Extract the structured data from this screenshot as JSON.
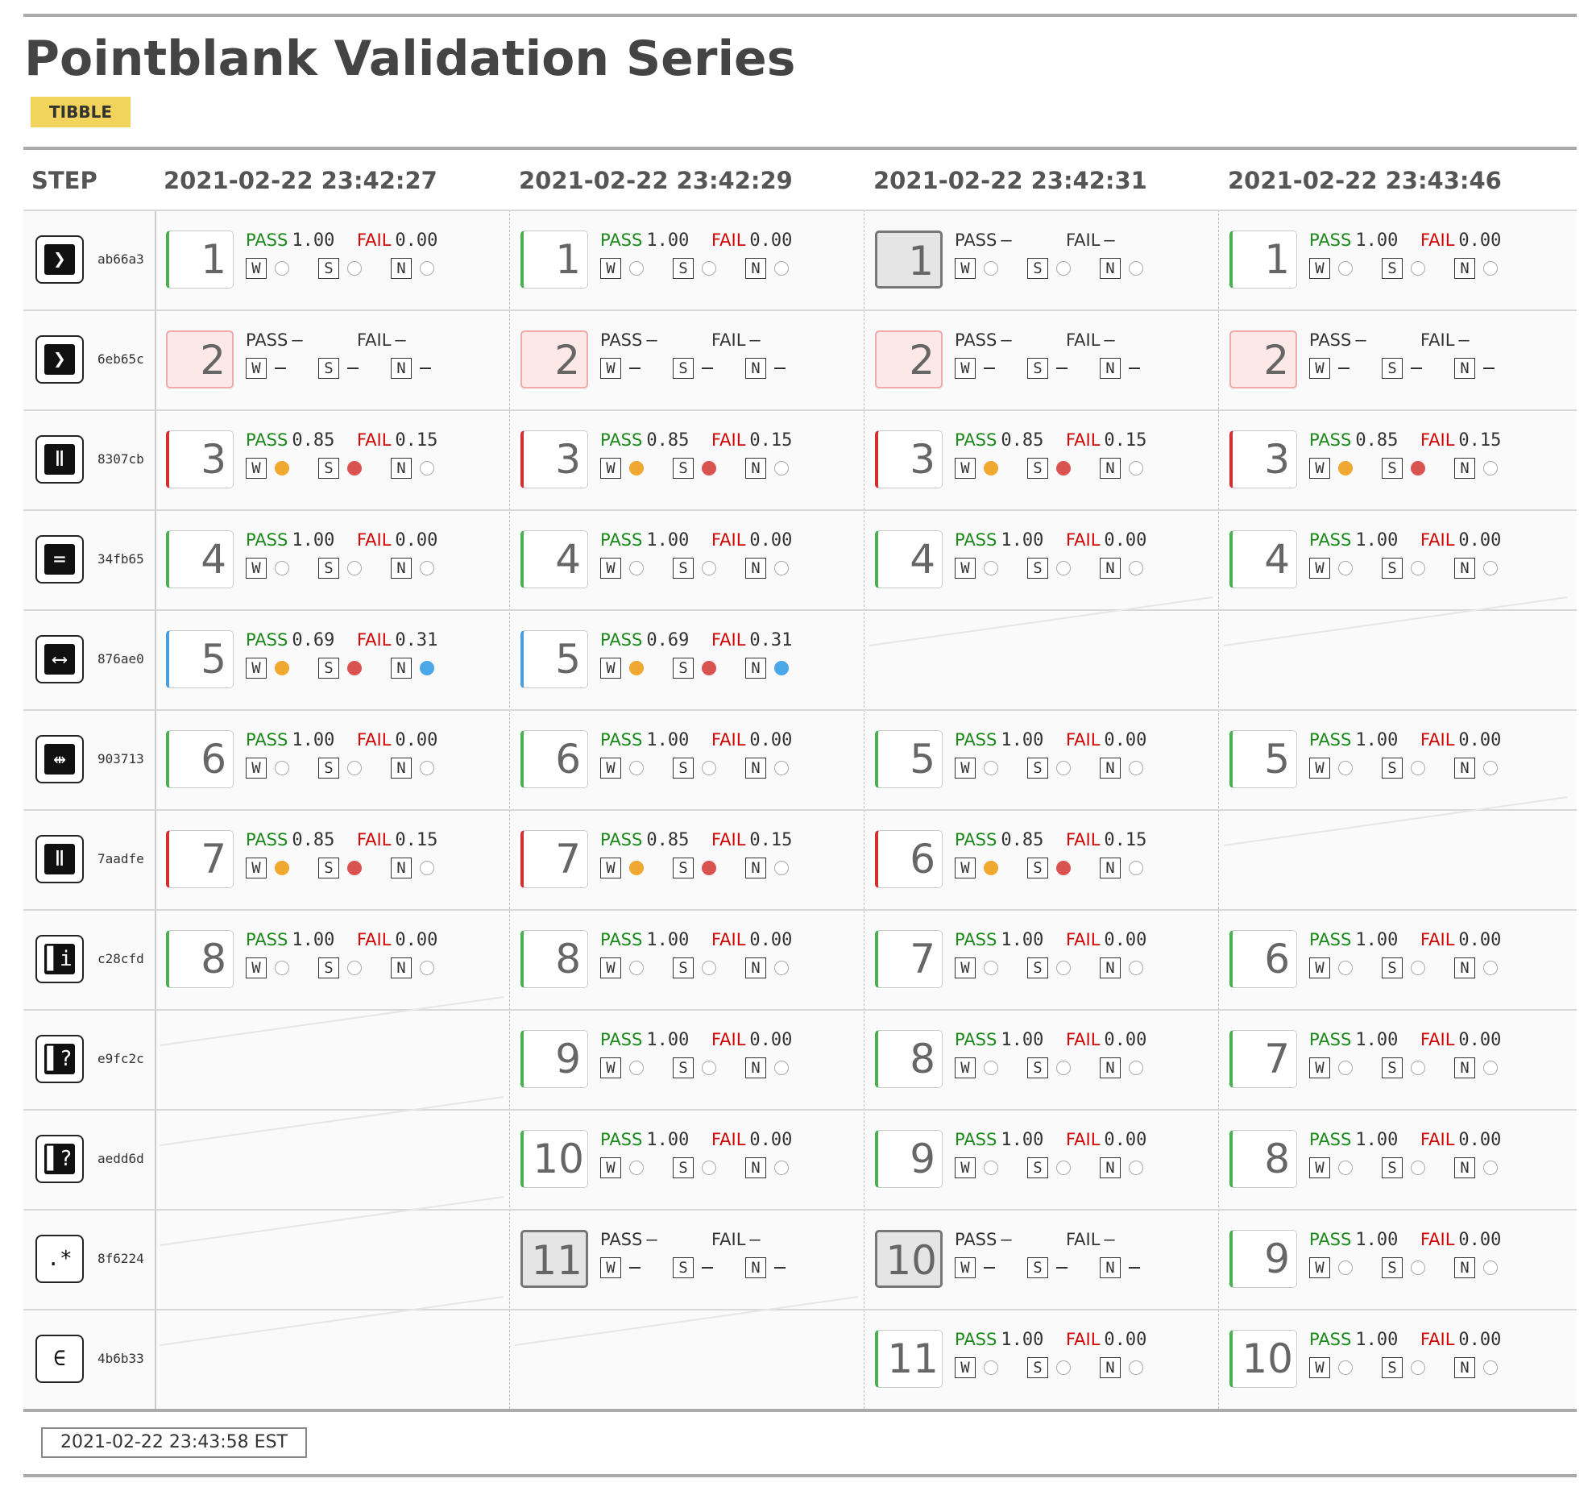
{
  "title": "Pointblank Validation Series",
  "badge": "TIBBLE",
  "columns": {
    "step_header": "STEP",
    "runs": [
      "2021-02-22 23:42:27",
      "2021-02-22 23:42:29",
      "2021-02-22 23:42:31",
      "2021-02-22 23:43:46"
    ]
  },
  "labels": {
    "pass": "PASS",
    "fail": "FAIL",
    "w": "W",
    "s": "S",
    "n": "N"
  },
  "colors": {
    "pass": "#1a8a1a",
    "fail": "#d30000",
    "warn": "#f0a830",
    "stop": "#d9534f",
    "notify": "#4aa8e8",
    "badge": "#f2d35b"
  },
  "steps": [
    {
      "hash": "ab66a3",
      "icon": "greater-than-icon",
      "glyph": "❯"
    },
    {
      "hash": "6eb65c",
      "icon": "greater-than-icon",
      "glyph": "❯"
    },
    {
      "hash": "8307cb",
      "icon": "between-icon",
      "glyph": "Ⅱ"
    },
    {
      "hash": "34fb65",
      "icon": "equals-icon",
      "glyph": "="
    },
    {
      "hash": "876ae0",
      "icon": "col-vals-between-icon",
      "glyph": "⟷"
    },
    {
      "hash": "903713",
      "icon": "col-vals-not-between-icon",
      "glyph": "⇹"
    },
    {
      "hash": "7aadfe",
      "icon": "between-icon",
      "glyph": "Ⅱ"
    },
    {
      "hash": "c28cfd",
      "icon": "col-is-info-icon",
      "glyph": "▌i"
    },
    {
      "hash": "e9fc2c",
      "icon": "col-exists-icon",
      "glyph": "▌?"
    },
    {
      "hash": "aedd6d",
      "icon": "col-exists-icon",
      "glyph": "▌?"
    },
    {
      "hash": "8f6224",
      "icon": "regex-icon",
      "glyph": ".*"
    },
    {
      "hash": "4b6b33",
      "icon": "in-set-icon",
      "glyph": "∈"
    }
  ],
  "cells": [
    [
      {
        "n": "1",
        "t": "pass",
        "p": "1.00",
        "f": "0.00",
        "w": "none",
        "s": "none",
        "nn": "none"
      },
      {
        "n": "1",
        "t": "pass",
        "p": "1.00",
        "f": "0.00",
        "w": "none",
        "s": "none",
        "nn": "none"
      },
      {
        "n": "1",
        "t": "inactive",
        "p": "—",
        "f": "—",
        "w": "none",
        "s": "none",
        "nn": "none"
      },
      {
        "n": "1",
        "t": "pass",
        "p": "1.00",
        "f": "0.00",
        "w": "none",
        "s": "none",
        "nn": "none"
      }
    ],
    [
      {
        "n": "2",
        "t": "err",
        "p": "—",
        "f": "—",
        "w": "dash",
        "s": "dash",
        "nn": "dash"
      },
      {
        "n": "2",
        "t": "err",
        "p": "—",
        "f": "—",
        "w": "dash",
        "s": "dash",
        "nn": "dash"
      },
      {
        "n": "2",
        "t": "err",
        "p": "—",
        "f": "—",
        "w": "dash",
        "s": "dash",
        "nn": "dash"
      },
      {
        "n": "2",
        "t": "err",
        "p": "—",
        "f": "—",
        "w": "dash",
        "s": "dash",
        "nn": "dash"
      }
    ],
    [
      {
        "n": "3",
        "t": "fail",
        "p": "0.85",
        "f": "0.15",
        "w": "warn",
        "s": "stop",
        "nn": "none"
      },
      {
        "n": "3",
        "t": "fail",
        "p": "0.85",
        "f": "0.15",
        "w": "warn",
        "s": "stop",
        "nn": "none"
      },
      {
        "n": "3",
        "t": "fail",
        "p": "0.85",
        "f": "0.15",
        "w": "warn",
        "s": "stop",
        "nn": "none"
      },
      {
        "n": "3",
        "t": "fail",
        "p": "0.85",
        "f": "0.15",
        "w": "warn",
        "s": "stop",
        "nn": "none"
      }
    ],
    [
      {
        "n": "4",
        "t": "pass",
        "p": "1.00",
        "f": "0.00",
        "w": "none",
        "s": "none",
        "nn": "none"
      },
      {
        "n": "4",
        "t": "pass",
        "p": "1.00",
        "f": "0.00",
        "w": "none",
        "s": "none",
        "nn": "none"
      },
      {
        "n": "4",
        "t": "pass",
        "p": "1.00",
        "f": "0.00",
        "w": "none",
        "s": "none",
        "nn": "none"
      },
      {
        "n": "4",
        "t": "pass",
        "p": "1.00",
        "f": "0.00",
        "w": "none",
        "s": "none",
        "nn": "none"
      }
    ],
    [
      {
        "n": "5",
        "t": "note",
        "p": "0.69",
        "f": "0.31",
        "w": "warn",
        "s": "stop",
        "nn": "notify"
      },
      {
        "n": "5",
        "t": "note",
        "p": "0.69",
        "f": "0.31",
        "w": "warn",
        "s": "stop",
        "nn": "notify"
      },
      null,
      null
    ],
    [
      {
        "n": "6",
        "t": "pass",
        "p": "1.00",
        "f": "0.00",
        "w": "none",
        "s": "none",
        "nn": "none"
      },
      {
        "n": "6",
        "t": "pass",
        "p": "1.00",
        "f": "0.00",
        "w": "none",
        "s": "none",
        "nn": "none"
      },
      {
        "n": "5",
        "t": "pass",
        "p": "1.00",
        "f": "0.00",
        "w": "none",
        "s": "none",
        "nn": "none"
      },
      {
        "n": "5",
        "t": "pass",
        "p": "1.00",
        "f": "0.00",
        "w": "none",
        "s": "none",
        "nn": "none"
      }
    ],
    [
      {
        "n": "7",
        "t": "fail",
        "p": "0.85",
        "f": "0.15",
        "w": "warn",
        "s": "stop",
        "nn": "none"
      },
      {
        "n": "7",
        "t": "fail",
        "p": "0.85",
        "f": "0.15",
        "w": "warn",
        "s": "stop",
        "nn": "none"
      },
      {
        "n": "6",
        "t": "fail",
        "p": "0.85",
        "f": "0.15",
        "w": "warn",
        "s": "stop",
        "nn": "none"
      },
      null
    ],
    [
      {
        "n": "8",
        "t": "pass",
        "p": "1.00",
        "f": "0.00",
        "w": "none",
        "s": "none",
        "nn": "none"
      },
      {
        "n": "8",
        "t": "pass",
        "p": "1.00",
        "f": "0.00",
        "w": "none",
        "s": "none",
        "nn": "none"
      },
      {
        "n": "7",
        "t": "pass",
        "p": "1.00",
        "f": "0.00",
        "w": "none",
        "s": "none",
        "nn": "none"
      },
      {
        "n": "6",
        "t": "pass",
        "p": "1.00",
        "f": "0.00",
        "w": "none",
        "s": "none",
        "nn": "none"
      }
    ],
    [
      null,
      {
        "n": "9",
        "t": "pass",
        "p": "1.00",
        "f": "0.00",
        "w": "none",
        "s": "none",
        "nn": "none"
      },
      {
        "n": "8",
        "t": "pass",
        "p": "1.00",
        "f": "0.00",
        "w": "none",
        "s": "none",
        "nn": "none"
      },
      {
        "n": "7",
        "t": "pass",
        "p": "1.00",
        "f": "0.00",
        "w": "none",
        "s": "none",
        "nn": "none"
      }
    ],
    [
      null,
      {
        "n": "10",
        "t": "pass",
        "p": "1.00",
        "f": "0.00",
        "w": "none",
        "s": "none",
        "nn": "none"
      },
      {
        "n": "9",
        "t": "pass",
        "p": "1.00",
        "f": "0.00",
        "w": "none",
        "s": "none",
        "nn": "none"
      },
      {
        "n": "8",
        "t": "pass",
        "p": "1.00",
        "f": "0.00",
        "w": "none",
        "s": "none",
        "nn": "none"
      }
    ],
    [
      null,
      {
        "n": "11",
        "t": "inactive",
        "p": "—",
        "f": "—",
        "w": "dash",
        "s": "dash",
        "nn": "dash"
      },
      {
        "n": "10",
        "t": "inactive",
        "p": "—",
        "f": "—",
        "w": "dash",
        "s": "dash",
        "nn": "dash"
      },
      {
        "n": "9",
        "t": "pass",
        "p": "1.00",
        "f": "0.00",
        "w": "none",
        "s": "none",
        "nn": "none"
      }
    ],
    [
      null,
      null,
      {
        "n": "11",
        "t": "pass",
        "p": "1.00",
        "f": "0.00",
        "w": "none",
        "s": "none",
        "nn": "none"
      },
      {
        "n": "10",
        "t": "pass",
        "p": "1.00",
        "f": "0.00",
        "w": "none",
        "s": "none",
        "nn": "none"
      }
    ]
  ],
  "footer": {
    "timestamp": "2021-02-22 23:43:58 EST"
  }
}
